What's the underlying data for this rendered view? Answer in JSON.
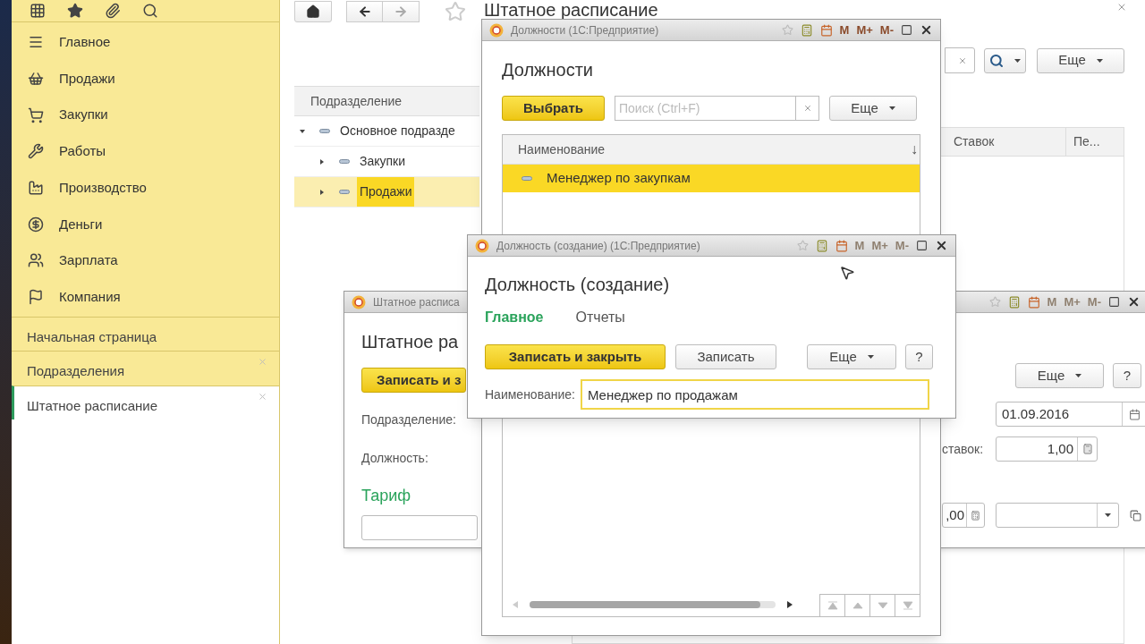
{
  "sidebar": {
    "sections": [
      {
        "label": "Главное"
      },
      {
        "label": "Продажи"
      },
      {
        "label": "Закупки"
      },
      {
        "label": "Работы"
      },
      {
        "label": "Производство"
      },
      {
        "label": "Деньги"
      },
      {
        "label": "Зарплата"
      },
      {
        "label": "Компания"
      }
    ],
    "open_windows": [
      {
        "label": "Начальная страница",
        "selected": false,
        "closable": false
      },
      {
        "label": "Подразделения",
        "selected": false,
        "closable": true
      },
      {
        "label": "Штатное расписание",
        "selected": true,
        "closable": true
      }
    ]
  },
  "main": {
    "title": "Штатное расписание",
    "more_button": "Еще",
    "tree": {
      "column": "Подразделение",
      "rows": [
        {
          "label": "Основное подразде",
          "expanded": true,
          "selected": false,
          "children": [
            {
              "label": "Закупки",
              "expanded": false,
              "selected": false
            },
            {
              "label": "Продажи",
              "expanded": false,
              "selected": true
            }
          ]
        }
      ]
    },
    "list_columns": [
      "Ставок",
      "Пе..."
    ]
  },
  "staffing_window": {
    "title_bar": "Штатное расписа",
    "heading": "Штатное ра",
    "save_button": "Записать и з",
    "labels": [
      "Подразделение:",
      "Должность:"
    ],
    "section": "Тариф",
    "more_button": "Еще",
    "help_button": "?",
    "date": "01.09.2016",
    "rate_label": "ставок:",
    "rate": "1,00",
    "amount": ",00",
    "memory_buttons": [
      {
        "label": "M",
        "disabled": true
      },
      {
        "label": "M+",
        "disabled": true
      },
      {
        "label": "M-",
        "disabled": true
      }
    ]
  },
  "positions_window": {
    "title_bar": "Должности  (1С:Предприятие)",
    "heading": "Должности",
    "select_button": "Выбрать",
    "search_placeholder": "Поиск (Ctrl+F)",
    "more_button": "Еще",
    "column": "Наименование",
    "sort_mark": "↓",
    "rows": [
      {
        "label": "Менеджер по закупкам",
        "selected": true
      }
    ],
    "memory_buttons": [
      {
        "label": "M",
        "disabled": false
      },
      {
        "label": "M+",
        "disabled": false
      },
      {
        "label": "M-",
        "disabled": false
      }
    ]
  },
  "creation_window": {
    "title_bar": "Должность (создание)  (1С:Предприятие)",
    "heading": "Должность (создание)",
    "tabs": [
      {
        "label": "Главное",
        "selected": true
      },
      {
        "label": "Отчеты",
        "selected": false
      }
    ],
    "save_close_button": "Записать и закрыть",
    "save_button": "Записать",
    "more_button": "Еще",
    "help_button": "?",
    "field": {
      "label": "Наименование:",
      "value": "Менеджер по продажам"
    },
    "memory_buttons": [
      {
        "label": "M",
        "disabled": true
      },
      {
        "label": "M+",
        "disabled": true
      },
      {
        "label": "M-",
        "disabled": true
      }
    ]
  }
}
